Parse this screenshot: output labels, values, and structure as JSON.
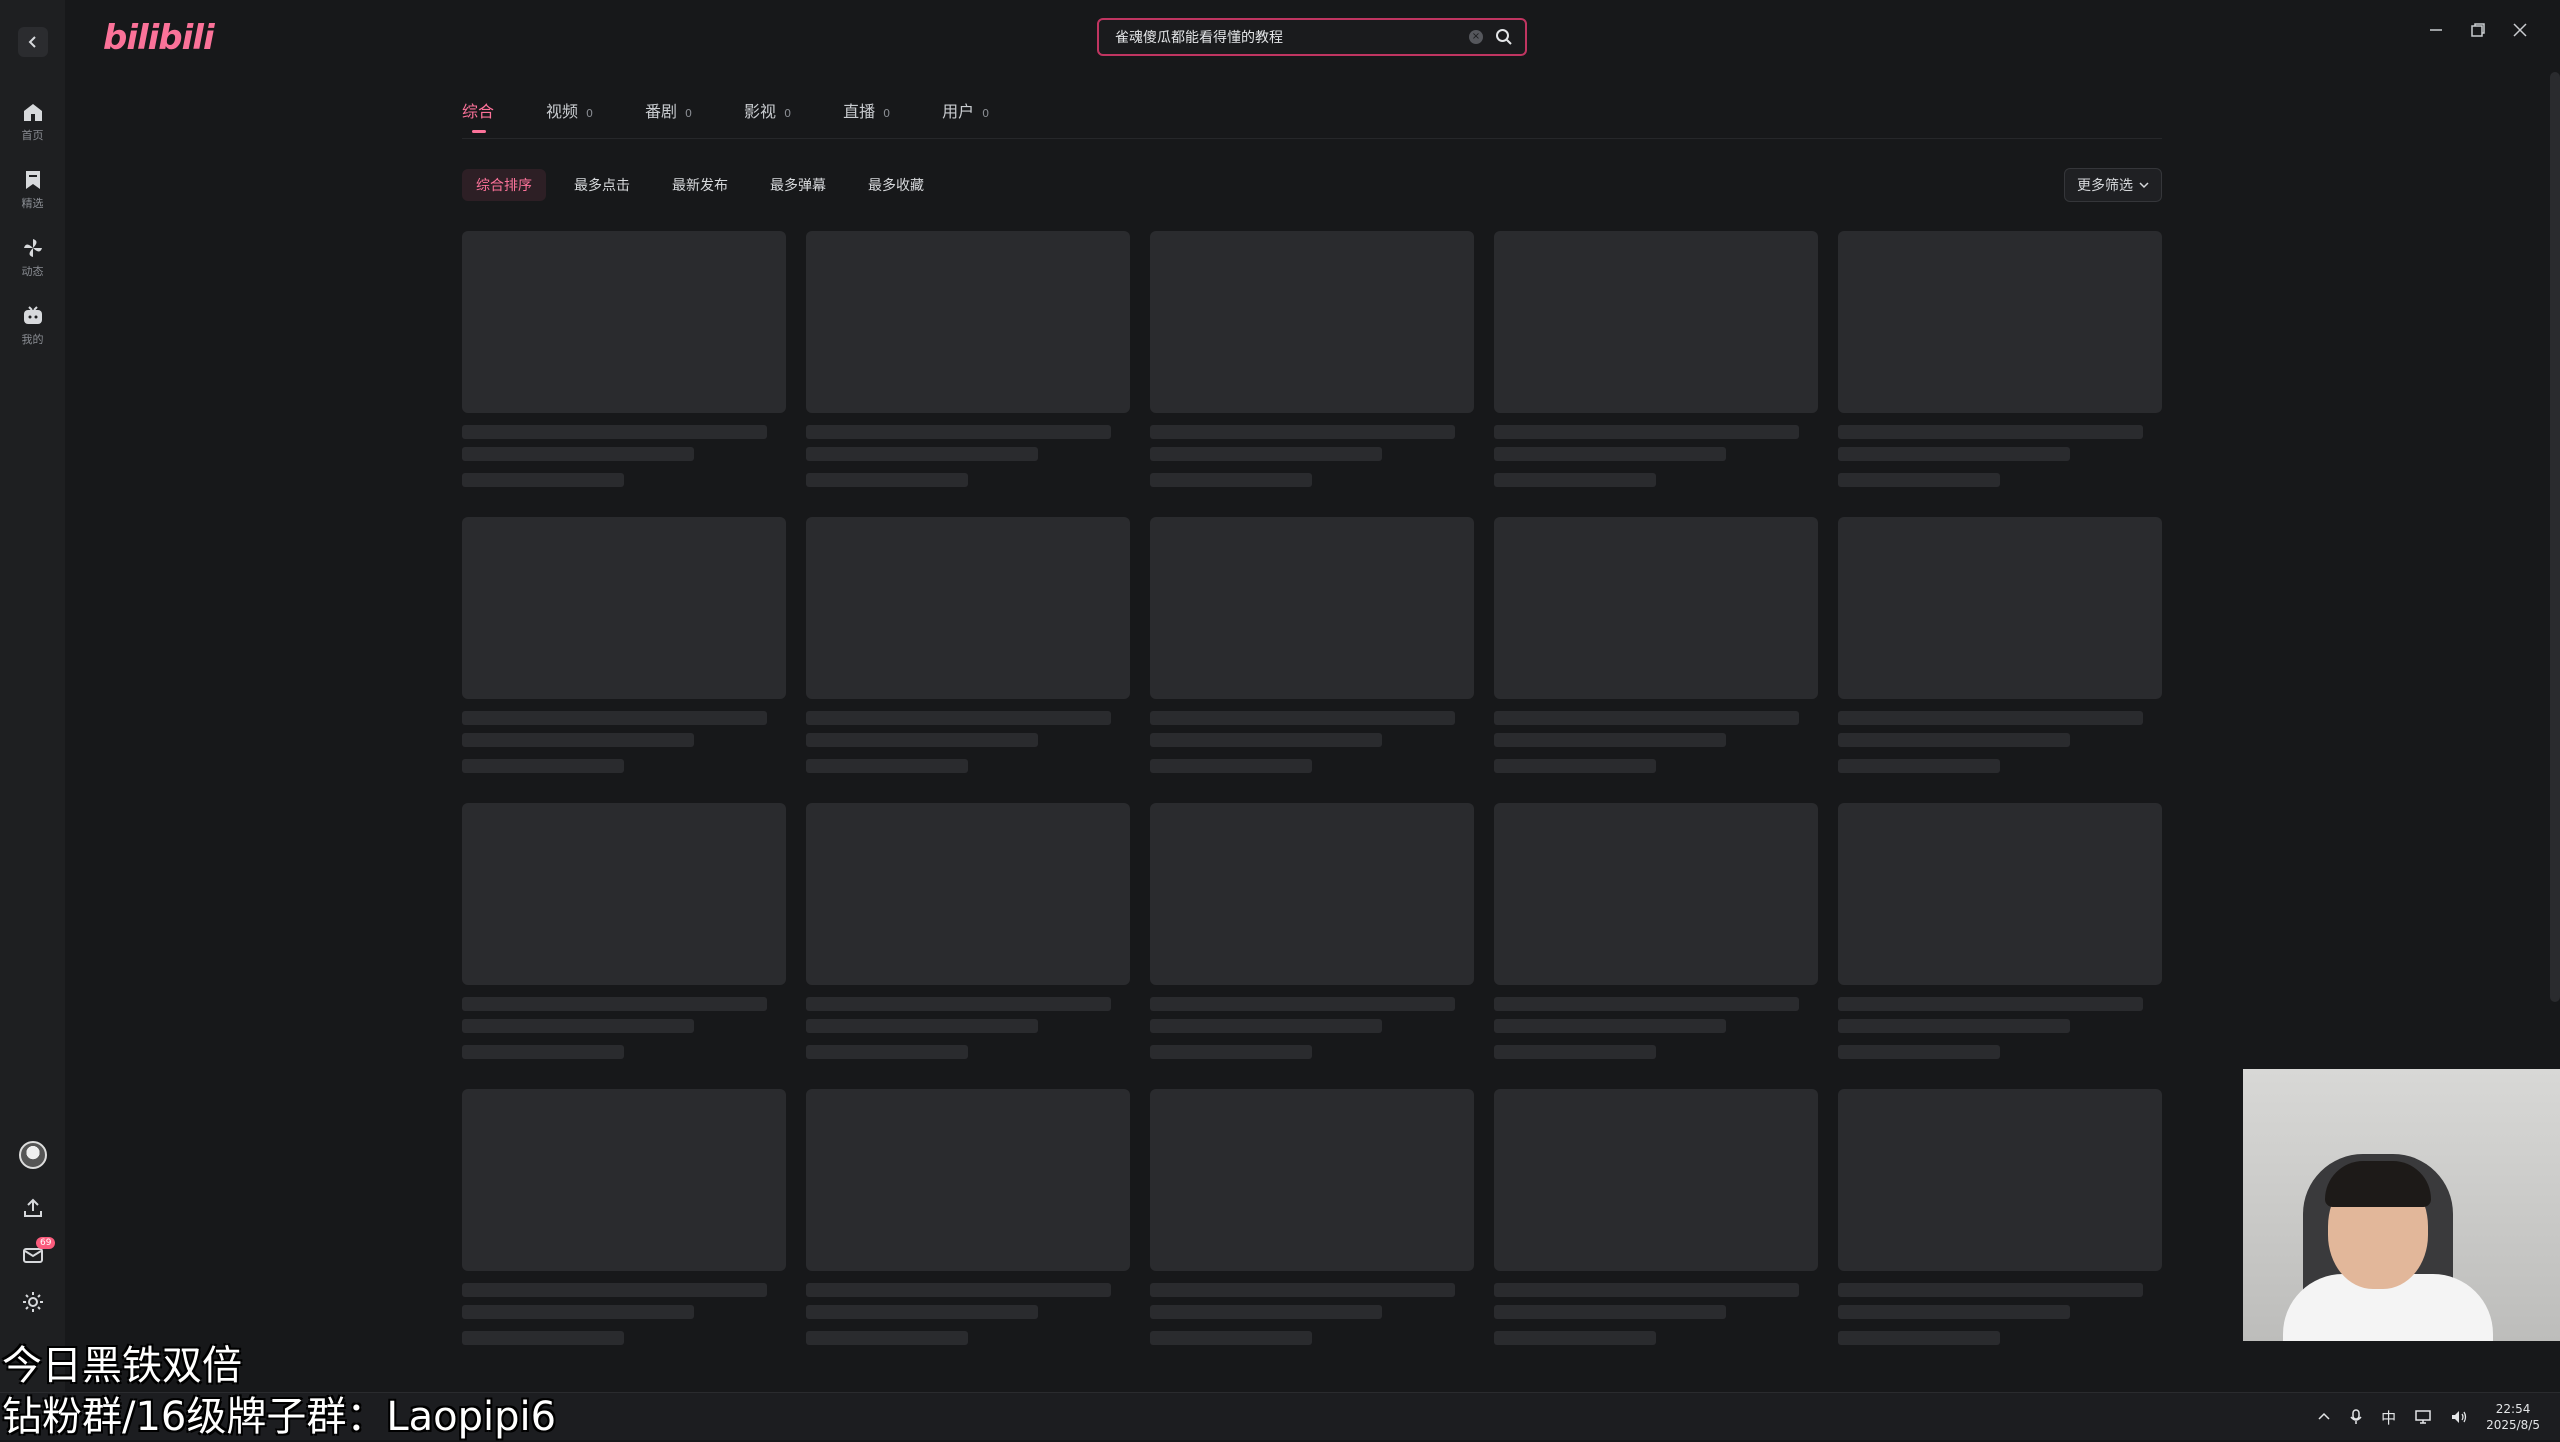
{
  "app": {
    "logo": "bilibili"
  },
  "sidebar": {
    "items": [
      {
        "label": "首页",
        "icon": "home-icon"
      },
      {
        "label": "精选",
        "icon": "bookmark-icon"
      },
      {
        "label": "动态",
        "icon": "pinwheel-icon"
      },
      {
        "label": "我的",
        "icon": "tv-icon"
      }
    ],
    "message_badge": "69"
  },
  "search": {
    "value": "雀魂傻瓜都能看得懂的教程"
  },
  "tabs": [
    {
      "label": "综合",
      "count": ""
    },
    {
      "label": "视频",
      "count": "0"
    },
    {
      "label": "番剧",
      "count": "0"
    },
    {
      "label": "影视",
      "count": "0"
    },
    {
      "label": "直播",
      "count": "0"
    },
    {
      "label": "用户",
      "count": "0"
    }
  ],
  "sorts": [
    "综合排序",
    "最多点击",
    "最新发布",
    "最多弹幕",
    "最多收藏"
  ],
  "more_filter": "更多筛选",
  "overlay": {
    "line1": "今日黑铁双倍",
    "line2": "钻粉群/16级牌子群：Laopipi6"
  },
  "taskbar": {
    "ime": "中",
    "time": "22:54",
    "date": "2025/8/5"
  },
  "colors": {
    "accent": "#fb7299",
    "background": "#17181a",
    "skeleton": "#2a2b2e"
  }
}
